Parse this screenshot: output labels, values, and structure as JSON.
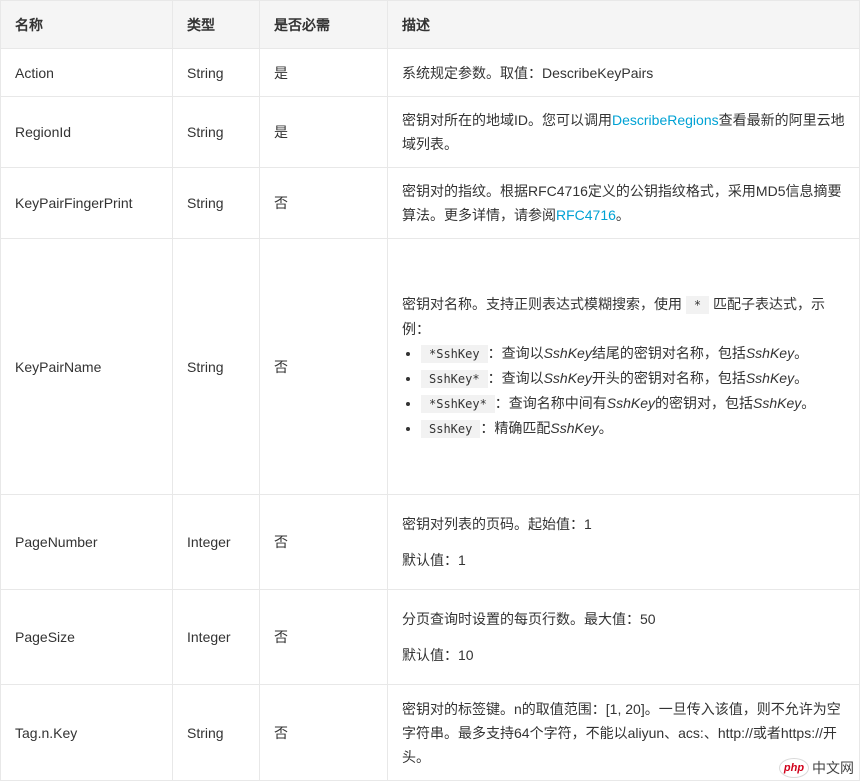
{
  "headers": {
    "name": "名称",
    "type": "类型",
    "required": "是否必需",
    "description": "描述"
  },
  "rows": [
    {
      "name": "Action",
      "type": "String",
      "required": "是",
      "desc": [
        "系统规定参数。取值：DescribeKeyPairs"
      ]
    },
    {
      "name": "RegionId",
      "type": "String",
      "required": "是",
      "desc_prefix": "密钥对所在的地域ID。您可以调用",
      "desc_link": "DescribeRegions",
      "desc_suffix": "查看最新的阿里云地域列表。"
    },
    {
      "name": "KeyPairFingerPrint",
      "type": "String",
      "required": "否",
      "desc_prefix": "密钥对的指纹。根据RFC4716定义的公钥指纹格式，采用MD5信息摘要算法。更多详情，请参阅",
      "desc_link": "RFC4716",
      "desc_suffix": "。"
    },
    {
      "name": "KeyPairName",
      "type": "String",
      "required": "否",
      "desc_prefix": "密钥对名称。支持正则表达式模糊搜索，使用",
      "desc_code": "*",
      "desc_suffix": "匹配子表达式，示例：",
      "examples": [
        {
          "code": "*SshKey",
          "text_a": "：查询以",
          "em": "SshKey",
          "text_b": "结尾的密钥对名称，包括",
          "em2": "SshKey",
          "text_c": "。"
        },
        {
          "code": "SshKey*",
          "text_a": "：查询以",
          "em": "SshKey",
          "text_b": "开头的密钥对名称，包括",
          "em2": "SshKey",
          "text_c": "。"
        },
        {
          "code": "*SshKey*",
          "text_a": "：查询名称中间有",
          "em": "SshKey",
          "text_b": "的密钥对，包括",
          "em2": "SshKey",
          "text_c": "。"
        },
        {
          "code": "SshKey",
          "text_a": "：精确匹配",
          "em": "SshKey",
          "text_b": "。",
          "em2": "",
          "text_c": ""
        }
      ]
    },
    {
      "name": "PageNumber",
      "type": "Integer",
      "required": "否",
      "desc": [
        "密钥对列表的页码。起始值：1",
        "默认值：1"
      ]
    },
    {
      "name": "PageSize",
      "type": "Integer",
      "required": "否",
      "desc": [
        "分页查询时设置的每页行数。最大值：50",
        "默认值：10"
      ]
    },
    {
      "name": "Tag.n.Key",
      "type": "String",
      "required": "否",
      "desc": [
        "密钥对的标签键。n的取值范围：[1, 20]。一旦传入该值，则不允许为空字符串。最多支持64个字符，不能以aliyun、acs:、http://或者https://开头。"
      ]
    }
  ],
  "watermark": {
    "logo": "php",
    "text": "中文网"
  }
}
